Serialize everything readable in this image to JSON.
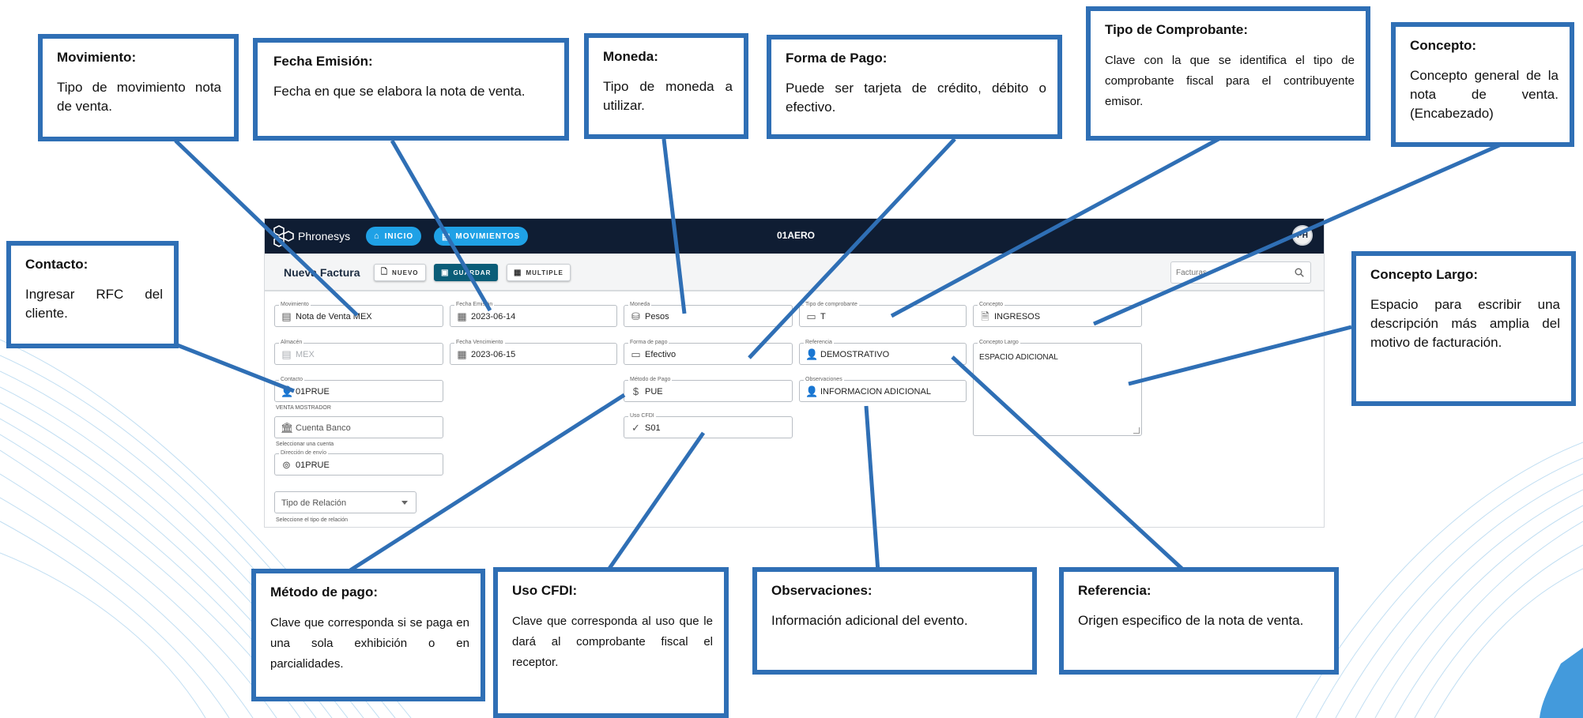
{
  "app": {
    "brand": "Phronesys",
    "nav": {
      "inicio": "INICIO",
      "movimientos": "MOVIMIENTOS"
    },
    "company": "01AERO",
    "avatar": "PH",
    "page_title": "Nueva Factura",
    "toolbar": {
      "nuevo": "NUEVO",
      "guardar": "GUARDAR",
      "multiple": "MULTIPLE"
    },
    "search_placeholder": "Facturas",
    "fields": {
      "movimiento": {
        "label": "Movimiento",
        "value": "Nota de Venta MEX"
      },
      "fecha_emision": {
        "label": "Fecha Emisión",
        "value": "2023-06-14"
      },
      "moneda": {
        "label": "Moneda",
        "value": "Pesos"
      },
      "tipo_comprobante": {
        "label": "Tipo de comprobante",
        "value": "T"
      },
      "concepto": {
        "label": "Concepto",
        "value": "INGRESOS"
      },
      "almacen": {
        "label": "Almacén",
        "value": "MEX"
      },
      "fecha_vencimiento": {
        "label": "Fecha Vencimiento",
        "value": "2023-06-15"
      },
      "forma_pago": {
        "label": "Forma de pago",
        "value": "Efectivo"
      },
      "referencia": {
        "label": "Referencia",
        "value": "DEMOSTRATIVO"
      },
      "concepto_largo": {
        "label": "Concepto Largo",
        "value": "ESPACIO ADICIONAL"
      },
      "contacto": {
        "label": "Contacto",
        "value": "01PRUE",
        "help": "VENTA MOSTRADOR"
      },
      "metodo_pago": {
        "label": "Método de Pago",
        "value": "PUE"
      },
      "observaciones": {
        "label": "Observaciones",
        "value": "INFORMACION ADICIONAL"
      },
      "cuenta_banco": {
        "value": "Cuenta Banco",
        "help": "Seleccionar una cuenta"
      },
      "uso_cfdi": {
        "label": "Uso CFDI",
        "value": "S01"
      },
      "direccion_envio": {
        "label": "Dirección de envío",
        "value": "01PRUE"
      },
      "tipo_relacion": {
        "value": "Tipo de Relación",
        "help": "Seleccione el tipo de relación"
      }
    }
  },
  "callouts": {
    "movimiento": {
      "title": "Movimiento:",
      "body": "Tipo de movimiento nota de venta."
    },
    "fecha_emision": {
      "title": "Fecha Emisión:",
      "body": "Fecha en que se elabora la nota de venta."
    },
    "moneda": {
      "title": "Moneda:",
      "body": "Tipo de moneda a utilizar."
    },
    "forma_pago": {
      "title": "Forma de Pago:",
      "body": "Puede ser tarjeta de crédito, débito o efectivo."
    },
    "tipo_comprobante": {
      "title": "Tipo de Comprobante:",
      "body": "Clave con la que se identifica el tipo de comprobante fiscal para el contribuyente emisor."
    },
    "concepto": {
      "title": "Concepto:",
      "body": "Concepto general de la nota de venta. (Encabezado)"
    },
    "contacto": {
      "title": "Contacto:",
      "body": "Ingresar RFC del cliente."
    },
    "concepto_largo": {
      "title": "Concepto Largo:",
      "body": "Espacio para escribir una descripción más amplia del motivo de facturación."
    },
    "metodo_pago": {
      "title": "Método de pago:",
      "body": "Clave que corresponda si se paga en una sola exhibición o en parcialidades."
    },
    "uso_cfdi": {
      "title": "Uso CFDI:",
      "body": "Clave que corresponda al uso que le dará al comprobante fiscal el receptor."
    },
    "observaciones": {
      "title": "Observaciones:",
      "body": "Información adicional del evento."
    },
    "referencia": {
      "title": "Referencia:",
      "body": "Origen especifico de la nota de venta."
    }
  },
  "colors": {
    "callout_border": "#2f6fb5",
    "topbar": "#0f1d33",
    "accent": "#1fa1e6"
  }
}
